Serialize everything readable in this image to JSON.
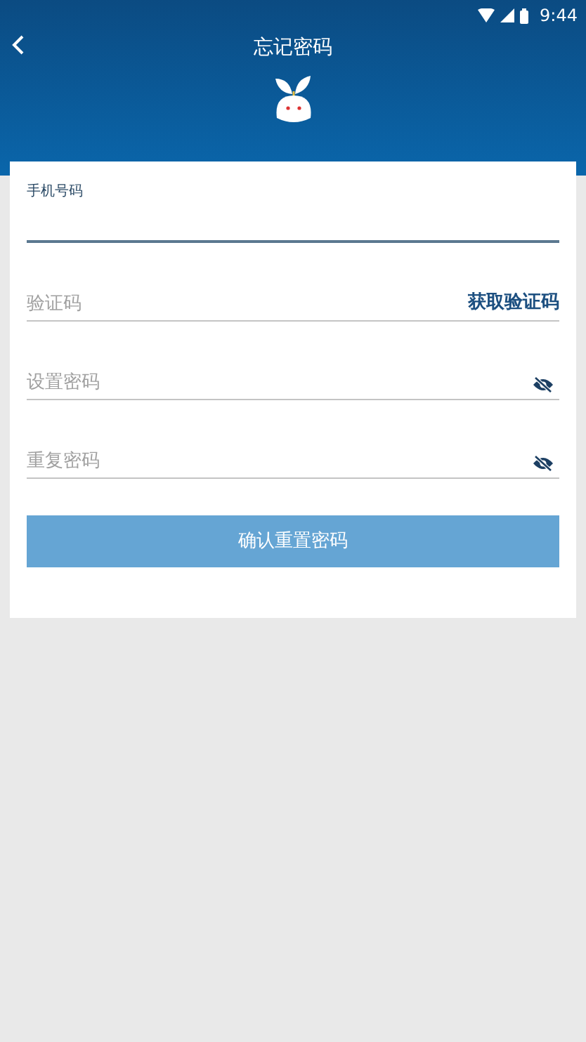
{
  "status_bar": {
    "time": "9:44"
  },
  "header": {
    "title": "忘记密码"
  },
  "fields": [
    {
      "kind": "floating",
      "label": "手机号码",
      "focused": true
    },
    {
      "kind": "code",
      "placeholder": "验证码",
      "focused": false,
      "action": "获取验证码"
    },
    {
      "kind": "password",
      "placeholder": "设置密码",
      "focused": false,
      "visible": false
    },
    {
      "kind": "password",
      "placeholder": "重复密码",
      "focused": false,
      "visible": false
    }
  ],
  "submit": {
    "label": "确认重置密码",
    "disabled": true
  }
}
